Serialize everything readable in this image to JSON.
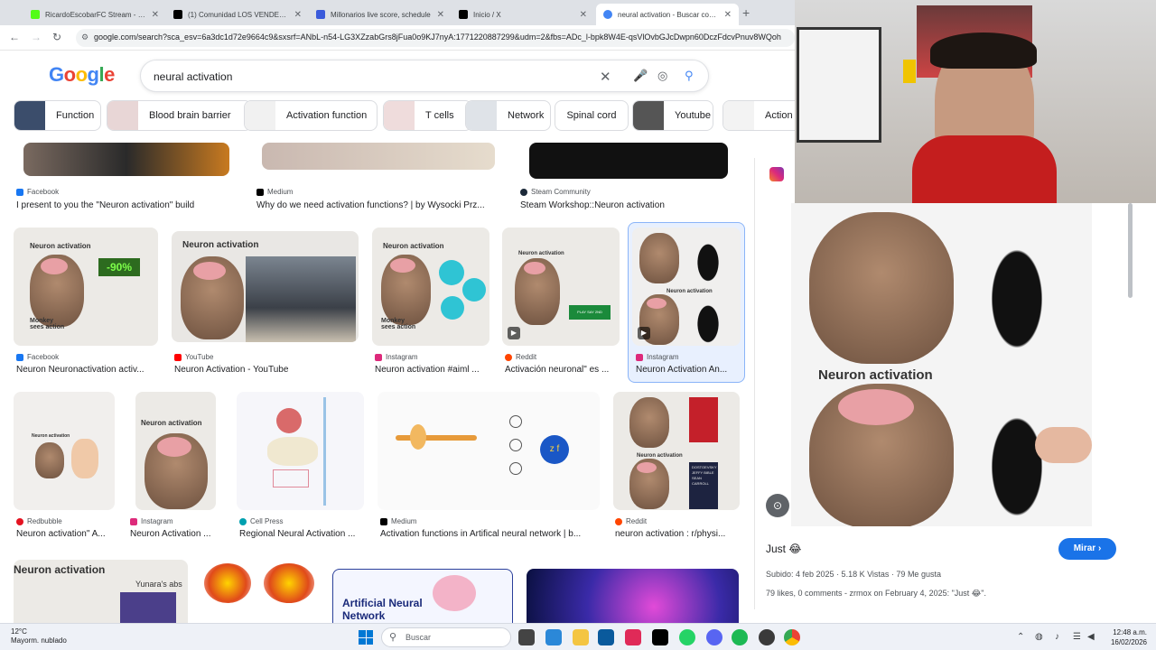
{
  "browser": {
    "tabs": [
      {
        "title": "RicardoEscobarFC Stream - Wa",
        "color": "#53fc18"
      },
      {
        "title": "(1) Comunidad LOS VENDEHUM",
        "color": "#000000"
      },
      {
        "title": "Millonarios live score, schedule",
        "color": "#3b5bdb"
      },
      {
        "title": "Inicio / X",
        "color": "#000000"
      },
      {
        "title": "neural activation - Buscar con G",
        "color": "#4285f4"
      }
    ],
    "url": "google.com/search?sca_esv=6a3dc1d72e9664c9&sxsrf=ANbL-n54-LG3XZzabGrs8jFua0o9KJ7nyA:1771220887299&udm=2&fbs=ADc_l-bpk8W4E-qsVlOvbGJcDwpn60DczFdcvPnuv8WQoh"
  },
  "google": {
    "logo": [
      "G",
      "o",
      "o",
      "g",
      "l",
      "e"
    ],
    "query": "neural activation"
  },
  "chips": [
    "Function",
    "Blood brain barrier",
    "Activation function",
    "T cells",
    "Network",
    "Spinal cord",
    "Youtube",
    "Action p"
  ],
  "results": {
    "row0": [
      {
        "source": "Facebook",
        "title": "I present to you the \"Neuron activation\" build",
        "src_color": "#1877f2"
      },
      {
        "source": "Medium",
        "title": "Why do we need activation functions? | by Wysocki Prz...",
        "src_color": "#000000"
      },
      {
        "source": "Steam Community",
        "title": "Steam Workshop::Neuron activation",
        "src_color": "#1b2838"
      }
    ],
    "row1": [
      {
        "source": "Facebook",
        "title": "Neuron Neuronactivation activ...",
        "src_color": "#1877f2",
        "label": "Neuron activation",
        "badge": "-90%",
        "caption": "Monkey sees action"
      },
      {
        "source": "YouTube",
        "title": "Neuron Activation - YouTube",
        "src_color": "#ff0000",
        "label": "Neuron activation"
      },
      {
        "source": "Instagram",
        "title": "Neuron activation #aiml ...",
        "src_color": "#dd2a7b",
        "label": "Neuron activation",
        "caption": "Monkey sees action"
      },
      {
        "source": "Reddit",
        "title": "Activación neuronal\" es ...",
        "src_color": "#ff4500",
        "label": "Neuron activation",
        "badge": "PLAY SAY 2ND"
      },
      {
        "source": "Instagram",
        "title": "Neuron Activation An...",
        "src_color": "#dd2a7b",
        "label": "Neuron activation"
      }
    ],
    "row2": [
      {
        "source": "Redbubble",
        "title": "Neuron activation\" A...",
        "src_color": "#e41321",
        "label": "Neuron activation"
      },
      {
        "source": "Instagram",
        "title": "Neuron Activation ...",
        "src_color": "#dd2a7b",
        "label": "Neuron activation"
      },
      {
        "source": "Cell Press",
        "title": "Regional Neural Activation ...",
        "src_color": "#00a0af"
      },
      {
        "source": "Medium",
        "title": "Activation functions in Artifical neural network | b...",
        "src_color": "#000000"
      },
      {
        "source": "Reddit",
        "title": "neuron activation : r/physi...",
        "src_color": "#ff4500",
        "label": "Neuron activation",
        "book": "DOSTOEVSKY JEFFY BIBLE SEAN CARROLL"
      }
    ],
    "row3": [
      {
        "label": "Neuron activation",
        "extra": "Yunara's abs"
      },
      {},
      {
        "label": "Artificial Neural Network"
      },
      {}
    ]
  },
  "side": {
    "image_label": "Neuron activation",
    "title": "Just 😂",
    "watch": "Mirar",
    "meta": "Subido: 4 feb 2025 · 5.18 K Vistas · 79 Me gusta",
    "desc": "79 likes, 0 comments - zrmox on February 4, 2025: \"Just 😂\"."
  },
  "taskbar": {
    "weather_temp": "12°C",
    "weather_desc": "Mayorm. nublado",
    "search": "Buscar",
    "time": "12:48 a.m.",
    "date": "16/02/2026"
  }
}
